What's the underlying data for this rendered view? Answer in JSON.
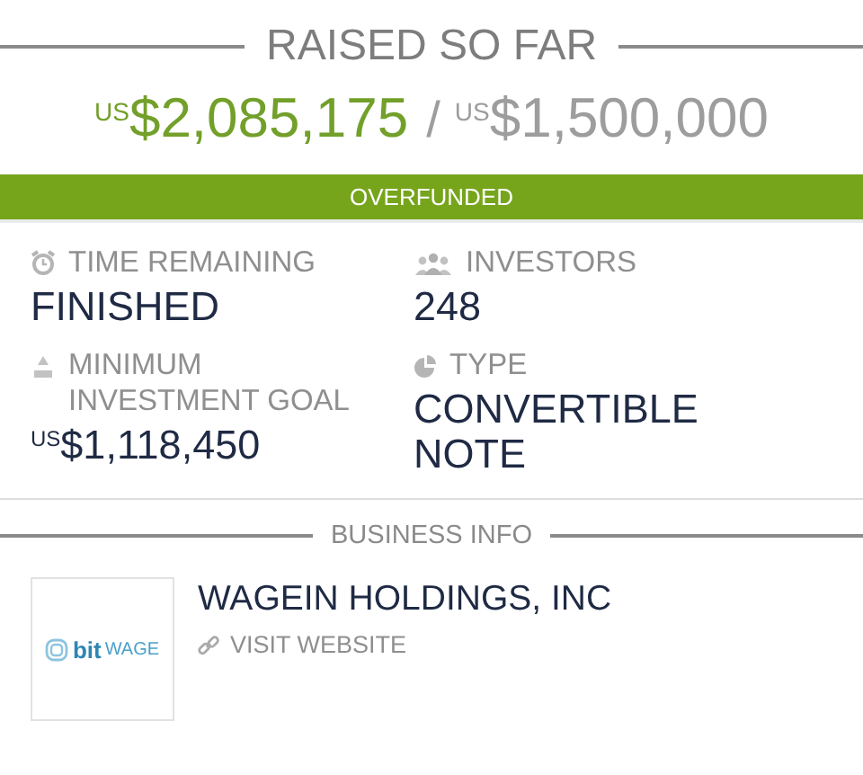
{
  "raised": {
    "heading": "RAISED SO FAR",
    "amount_currency": "US",
    "amount": "$2,085,175",
    "separator": "/",
    "goal_currency": "US",
    "goal": "$1,500,000"
  },
  "status_banner": "OVERFUNDED",
  "stats": [
    {
      "kind": "clock",
      "label": "TIME REMAINING",
      "value": "FINISHED"
    },
    {
      "kind": "people",
      "label": "INVESTORS",
      "value": "248"
    },
    {
      "kind": "min",
      "label": "MINIMUM INVESTMENT GOAL",
      "currency": "US",
      "value": "$1,118,450"
    },
    {
      "kind": "pie",
      "label": "TYPE",
      "value": "CONVERTIBLE NOTE"
    }
  ],
  "business_info": {
    "heading": "BUSINESS INFO",
    "logo_bold": "bit",
    "logo_rest": "WAGE",
    "company": "WAGEIN HOLDINGS, INC",
    "link": "VISIT WEBSITE"
  }
}
